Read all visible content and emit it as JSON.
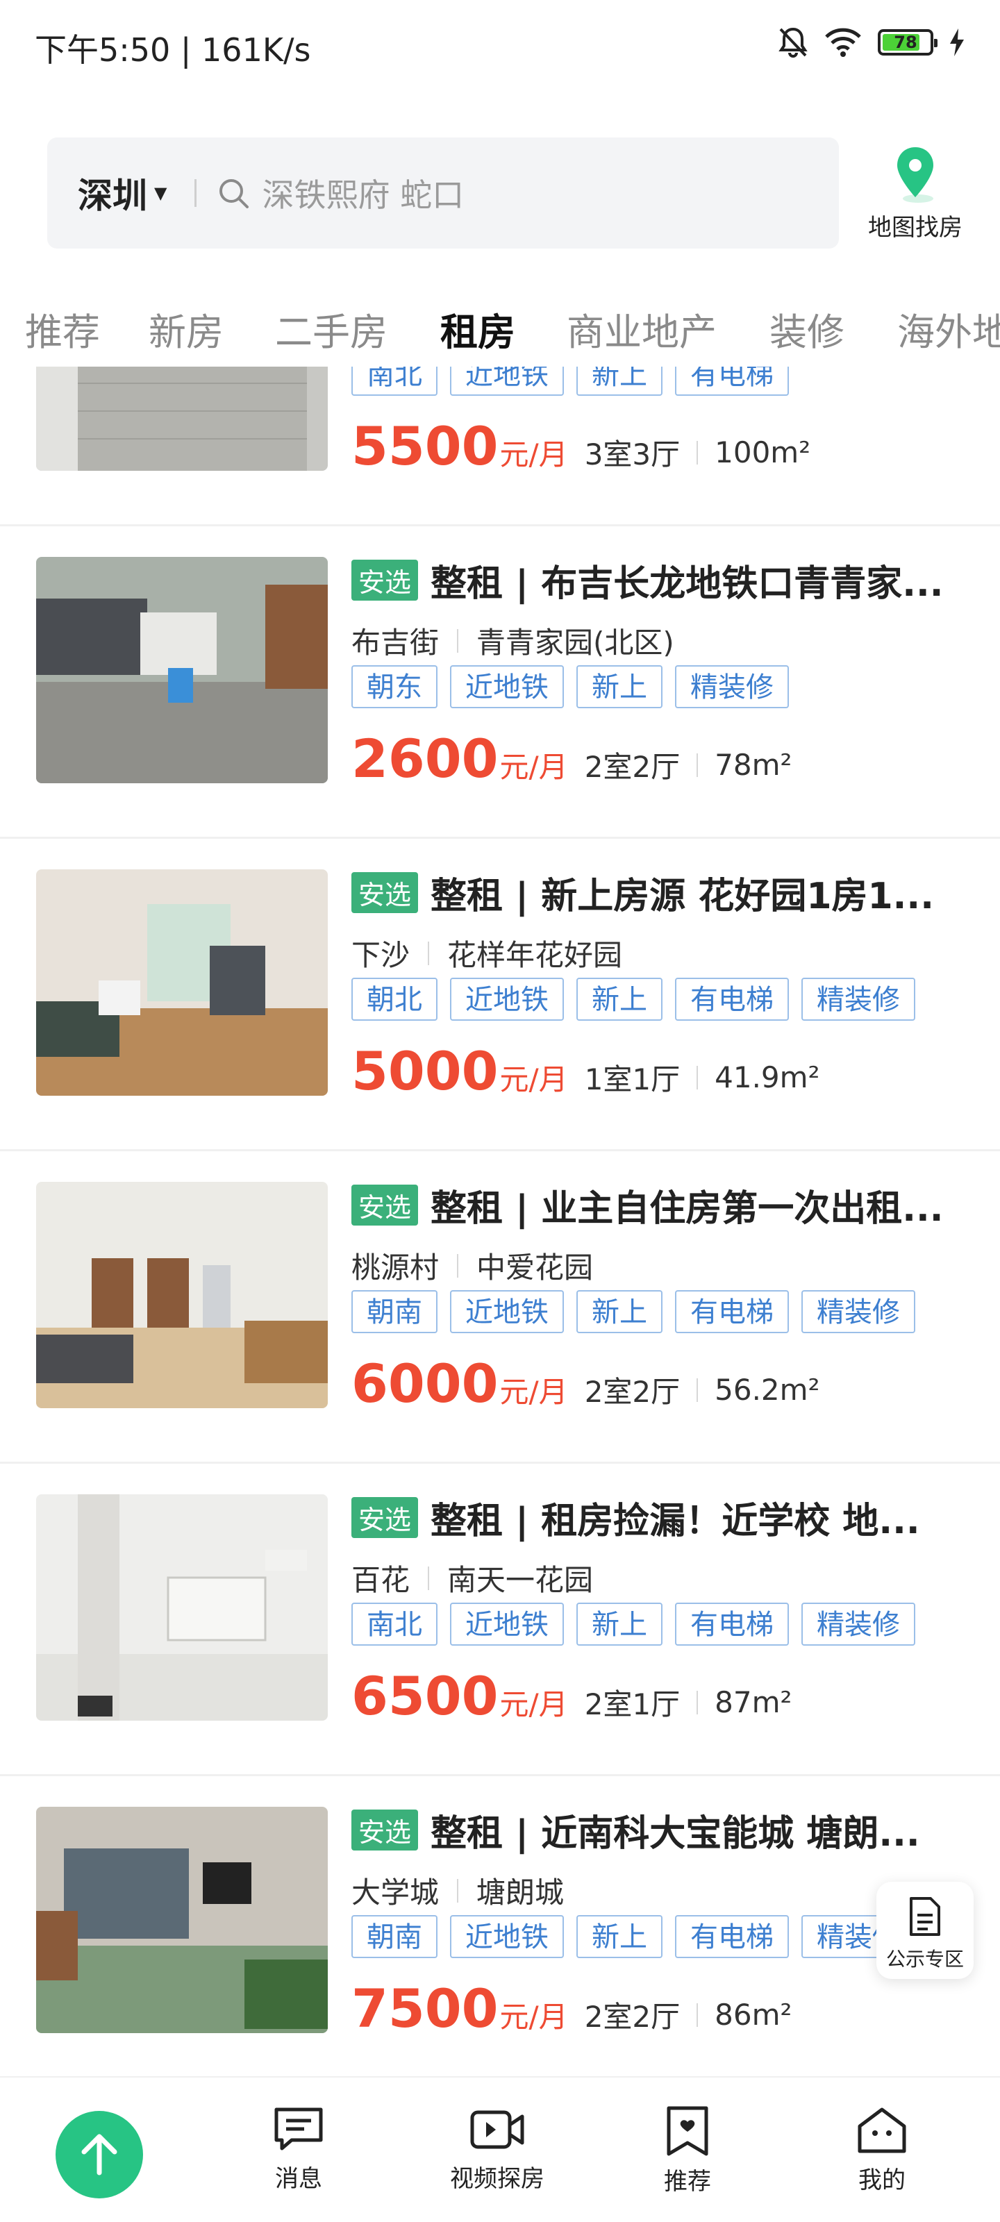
{
  "status_bar": {
    "time_speed": "下午5:50 | 161K/s",
    "battery": "78"
  },
  "search": {
    "city": "深圳",
    "placeholder": "深铁熙府 蛇口",
    "map_label": "地图找房"
  },
  "tabs": [
    "推荐",
    "新房",
    "二手房",
    "租房",
    "商业地产",
    "装修",
    "海外地"
  ],
  "active_tab": "租房",
  "listings": [
    {
      "badge": "",
      "title": "",
      "area": "",
      "community": "",
      "tags": [
        "南北",
        "近地铁",
        "新上",
        "有电梯"
      ],
      "price": "5500",
      "unit": "元/月",
      "layout": "3室3厅",
      "size": "100m²"
    },
    {
      "badge": "安选",
      "title": "整租 | 布吉长龙地铁口青青家...",
      "area": "布吉街",
      "community": "青青家园(北区)",
      "tags": [
        "朝东",
        "近地铁",
        "新上",
        "精装修"
      ],
      "price": "2600",
      "unit": "元/月",
      "layout": "2室2厅",
      "size": "78m²"
    },
    {
      "badge": "安选",
      "title": "整租 | 新上房源 花好园1房1...",
      "area": "下沙",
      "community": "花样年花好园",
      "tags": [
        "朝北",
        "近地铁",
        "新上",
        "有电梯",
        "精装修"
      ],
      "price": "5000",
      "unit": "元/月",
      "layout": "1室1厅",
      "size": "41.9m²"
    },
    {
      "badge": "安选",
      "title": "整租 | 业主自住房第一次出租...",
      "area": "桃源村",
      "community": "中爱花园",
      "tags": [
        "朝南",
        "近地铁",
        "新上",
        "有电梯",
        "精装修"
      ],
      "price": "6000",
      "unit": "元/月",
      "layout": "2室2厅",
      "size": "56.2m²"
    },
    {
      "badge": "安选",
      "title": "整租 | 租房捡漏！近学校 地...",
      "area": "百花",
      "community": "南天一花园",
      "tags": [
        "南北",
        "近地铁",
        "新上",
        "有电梯",
        "精装修"
      ],
      "price": "6500",
      "unit": "元/月",
      "layout": "2室1厅",
      "size": "87m²"
    },
    {
      "badge": "安选",
      "title": "整租 | 近南科大宝能城 塘朗...",
      "area": "大学城",
      "community": "塘朗城",
      "tags": [
        "朝南",
        "近地铁",
        "新上",
        "有电梯",
        "精装修"
      ],
      "price": "7500",
      "unit": "元/月",
      "layout": "2室2厅",
      "size": "86m²"
    }
  ],
  "notice_fab": {
    "label": "公示专区"
  },
  "bottom_nav": {
    "messages": "消息",
    "video": "视频探房",
    "recommend": "推荐",
    "mine": "我的"
  },
  "colors": {
    "accent": "#27c484",
    "price": "#ee4b33",
    "tag": "#3d7fd0",
    "badge": "#3bb07a"
  }
}
